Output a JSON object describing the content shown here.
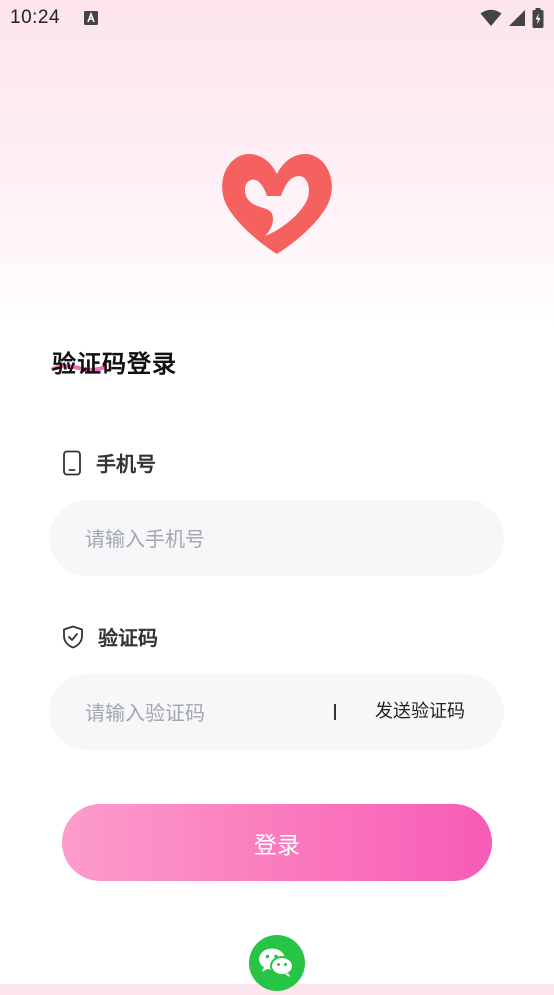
{
  "status_bar": {
    "time": "10:24",
    "icons": [
      "a-badge-icon",
      "wifi-icon",
      "signal-icon",
      "battery-charging-icon"
    ]
  },
  "logo": {
    "icon": "heart-logo-icon",
    "color": "#f4615f"
  },
  "title": {
    "text": "验证码登录",
    "underline_color": "#f06fb6"
  },
  "phone_field": {
    "label": "手机号",
    "icon": "phone-icon",
    "placeholder": "请输入手机号",
    "value": ""
  },
  "code_field": {
    "label": "验证码",
    "icon": "shield-check-icon",
    "placeholder": "请输入验证码",
    "value": "",
    "send_code_label": "发送验证码"
  },
  "login_button": {
    "label": "登录",
    "gradient": [
      "#fd9ccc",
      "#f75bb6"
    ]
  },
  "third_party": {
    "icon": "wechat-icon",
    "color": "#28c445"
  }
}
